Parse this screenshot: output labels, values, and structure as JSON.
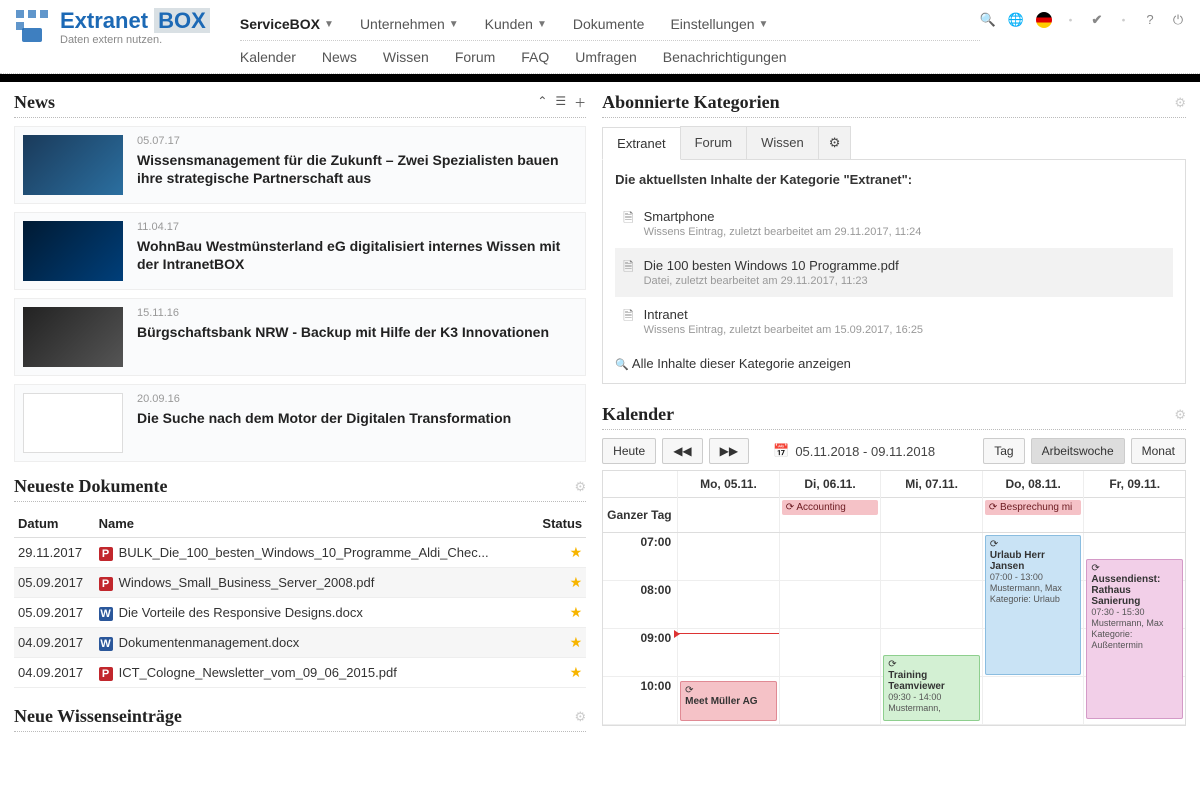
{
  "brand": {
    "name1": "Extranet",
    "name2": "BOX",
    "sub": "Daten extern nutzen."
  },
  "nav1": [
    {
      "label": "ServiceBOX",
      "active": true,
      "dd": true
    },
    {
      "label": "Unternehmen",
      "dd": true
    },
    {
      "label": "Kunden",
      "dd": true
    },
    {
      "label": "Dokumente",
      "dd": false
    },
    {
      "label": "Einstellungen",
      "dd": true
    }
  ],
  "nav2": [
    {
      "label": "Kalender"
    },
    {
      "label": "News"
    },
    {
      "label": "Wissen"
    },
    {
      "label": "Forum"
    },
    {
      "label": "FAQ"
    },
    {
      "label": "Umfragen"
    },
    {
      "label": "Benachrichtigungen"
    }
  ],
  "news": {
    "title": "News",
    "items": [
      {
        "date": "05.07.17",
        "title": "Wissensmanagement für die Zukunft – Zwei Spezialisten bauen ihre strategische Partnerschaft aus",
        "thumb": "t1"
      },
      {
        "date": "11.04.17",
        "title": "WohnBau Westmünsterland eG digitalisiert internes Wissen mit der IntranetBOX",
        "thumb": "t2"
      },
      {
        "date": "15.11.16",
        "title": "Bürgschaftsbank NRW - Backup mit Hilfe der K3 Innovationen",
        "thumb": "t3"
      },
      {
        "date": "20.09.16",
        "title": "Die Suche nach dem Motor der Digitalen Transformation",
        "thumb": "t4"
      }
    ]
  },
  "docs": {
    "title": "Neueste Dokumente",
    "cols": {
      "date": "Datum",
      "name": "Name",
      "status": "Status"
    },
    "rows": [
      {
        "date": "29.11.2017",
        "type": "pdf",
        "name": "BULK_Die_100_besten_Windows_10_Programme_Aldi_Chec..."
      },
      {
        "date": "05.09.2017",
        "type": "pdf",
        "name": "Windows_Small_Business_Server_2008.pdf"
      },
      {
        "date": "05.09.2017",
        "type": "docx",
        "name": "Die Vorteile des Responsive Designs.docx"
      },
      {
        "date": "04.09.2017",
        "type": "docx",
        "name": "Dokumentenmanagement.docx"
      },
      {
        "date": "04.09.2017",
        "type": "pdf",
        "name": "ICT_Cologne_Newsletter_vom_09_06_2015.pdf"
      }
    ]
  },
  "wissen": {
    "title": "Neue Wissenseinträge"
  },
  "cats": {
    "title": "Abonnierte Kategorien",
    "tabs": [
      "Extranet",
      "Forum",
      "Wissen"
    ],
    "head": "Die aktuellsten Inhalte der Kategorie \"Extranet\":",
    "items": [
      {
        "name": "Smartphone",
        "meta": "Wissens Eintrag, zuletzt bearbeitet am 29.11.2017, 11:24"
      },
      {
        "name": "Die 100 besten Windows 10 Programme.pdf",
        "meta": "Datei, zuletzt bearbeitet am 29.11.2017, 11:23"
      },
      {
        "name": "Intranet",
        "meta": "Wissens Eintrag, zuletzt bearbeitet am 15.09.2017, 16:25"
      }
    ],
    "all": "Alle Inhalte dieser Kategorie anzeigen"
  },
  "cal": {
    "title": "Kalender",
    "today": "Heute",
    "range": "05.11.2018 - 09.11.2018",
    "views": {
      "day": "Tag",
      "week": "Arbeitswoche",
      "month": "Monat"
    },
    "days": [
      "Mo, 05.11.",
      "Di, 06.11.",
      "Mi, 07.11.",
      "Do, 08.11.",
      "Fr, 09.11."
    ],
    "allday_label": "Ganzer Tag",
    "allday": {
      "1": "Accounting",
      "3": "Besprechung mi"
    },
    "hours": [
      "07:00",
      "08:00",
      "09:00",
      "10:00"
    ],
    "events": {
      "mo_meet": {
        "title": "Meet Müller AG"
      },
      "mi_train": {
        "title": "Training Teamviewer",
        "meta": "09:30 - 14:00 Mustermann,"
      },
      "do_urlaub": {
        "title": "Urlaub Herr Jansen",
        "meta1": "07:00 - 13:00 Mustermann, Max",
        "meta2": "Kategorie: Urlaub"
      },
      "fr_aussen": {
        "title": "Aussendienst: Rathaus Sanierung",
        "meta1": "07:30 - 15:30 Mustermann, Max",
        "meta2": "Kategorie: Außentermin"
      }
    }
  }
}
